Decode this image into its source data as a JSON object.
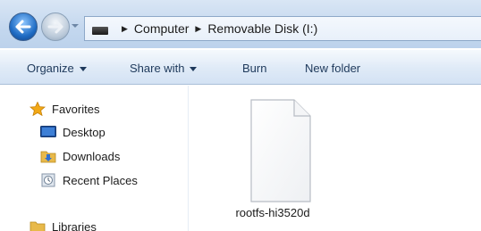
{
  "address_bar": {
    "breadcrumbs": [
      "Computer",
      "Removable Disk (I:)"
    ]
  },
  "toolbar": {
    "organize": "Organize",
    "share_with": "Share with",
    "burn": "Burn",
    "new_folder": "New folder"
  },
  "navigation": {
    "items": [
      {
        "label": "Favorites",
        "icon": "star-icon"
      },
      {
        "label": "Desktop",
        "icon": "desktop-icon"
      },
      {
        "label": "Downloads",
        "icon": "downloads-folder-icon"
      },
      {
        "label": "Recent Places",
        "icon": "recent-places-icon"
      },
      {
        "label": "Libraries",
        "icon": "libraries-icon"
      }
    ]
  },
  "files": [
    {
      "name": "rootfs-hi3520d",
      "icon": "blank-file-icon"
    }
  ],
  "colors": {
    "accent": "#1f6cc4",
    "toolbar_text": "#1e395b",
    "favorites_star": "#f2a816"
  }
}
